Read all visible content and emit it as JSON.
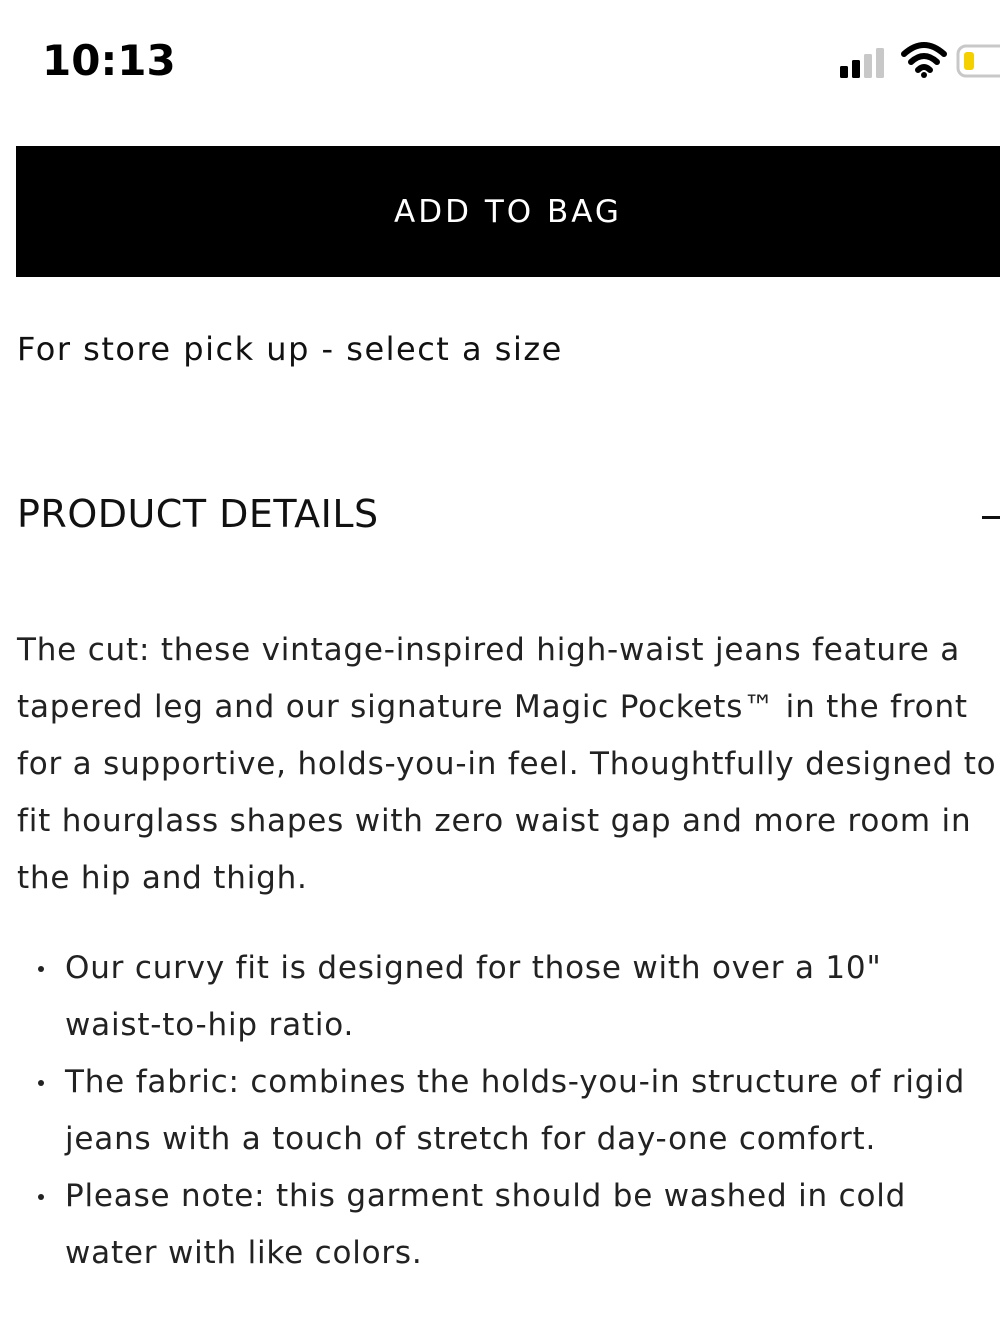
{
  "status_bar": {
    "time": "10:13",
    "signal_icon": "cellular-signal-icon",
    "wifi_icon": "wifi-icon",
    "battery_icon": "battery-low-icon"
  },
  "actions": {
    "add_to_bag_label": "ADD TO BAG",
    "store_pickup_text": "For store pick up - select a size"
  },
  "product_details": {
    "title": "PRODUCT DETAILS",
    "toggle_icon": "minus-collapse-icon",
    "description": "The cut: these vintage-inspired high-waist jeans feature a tapered leg and our signature Magic Pockets™ in the front for a supportive, holds-you-in feel. Thoughtfully designed to fit hourglass shapes with zero waist gap and more room in the hip and thigh.",
    "bullets": [
      "Our curvy fit is designed for those with over a 10\" waist-to-hip ratio.",
      "The fabric: combines the holds-you-in structure of rigid jeans with a touch of stretch for day-one comfort.",
      "Please note: this garment should be washed in cold water with like colors."
    ]
  },
  "colors": {
    "button_background": "#000000",
    "button_text": "#ffffff",
    "battery_level": "#f5d000"
  }
}
